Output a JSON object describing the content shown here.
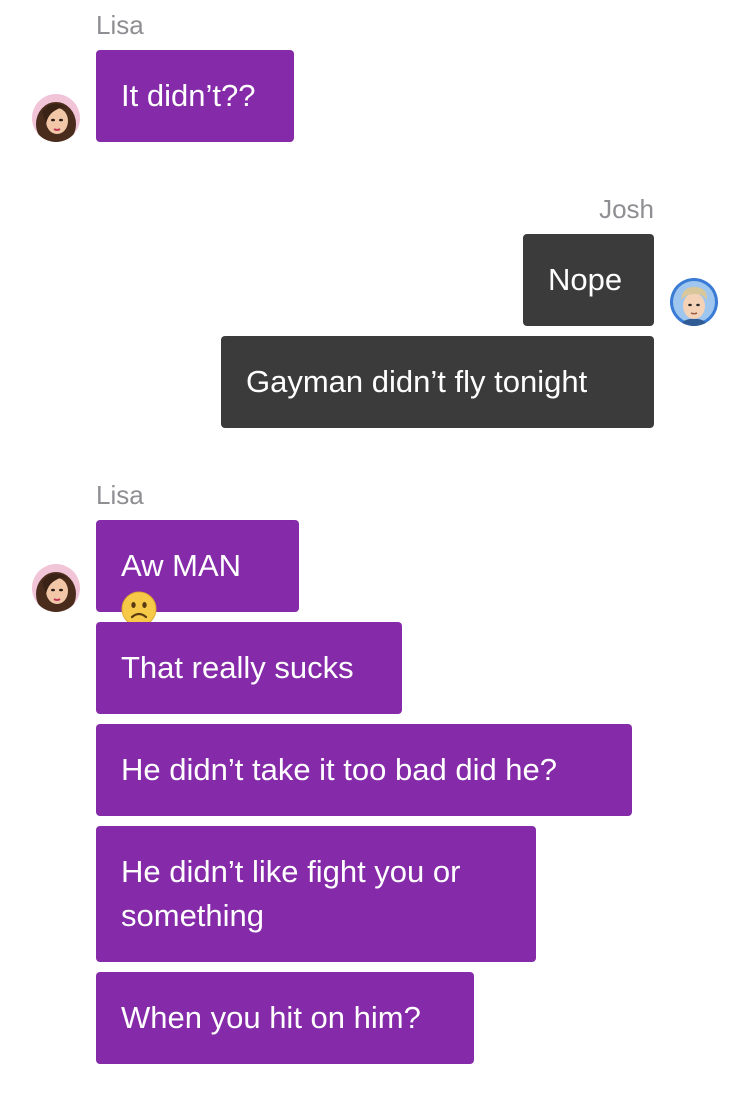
{
  "conversation": {
    "groups": [
      {
        "sender": "Lisa",
        "direction": "incoming",
        "messages": [
          "It didn’t??"
        ]
      },
      {
        "sender": "Josh",
        "direction": "outgoing",
        "messages": [
          "Nope",
          "Gayman didn’t fly tonight"
        ]
      },
      {
        "sender": "Lisa",
        "direction": "incoming",
        "messages": [
          {
            "text": "Aw MAN",
            "emoji": "frowning-face-emoji"
          },
          "That really sucks",
          "He didn’t take it too bad did he?",
          "He didn’t like fight you or something",
          "When you hit on him?"
        ]
      }
    ]
  },
  "colors": {
    "incoming_bubble": "#852aa8",
    "outgoing_bubble": "#3b3b3b",
    "sender_name": "#8e8e93",
    "background": "#ffffff"
  },
  "icons": {
    "lisa_avatar": "lisa-avatar-icon",
    "josh_avatar": "josh-avatar-icon",
    "emoji": "frowning-face-emoji"
  }
}
